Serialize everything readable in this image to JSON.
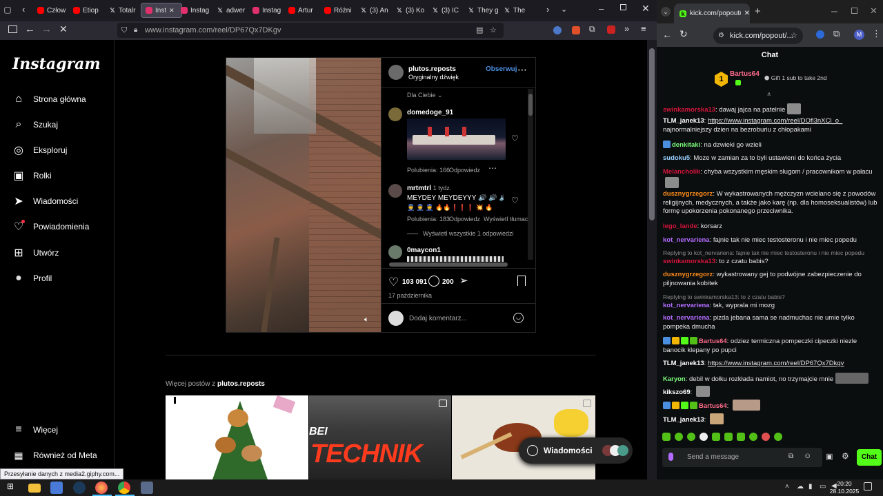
{
  "firefox": {
    "tabs": [
      {
        "label": "Człow",
        "icon": "youtube-icon",
        "color": "#ff0000"
      },
      {
        "label": "Etiop",
        "icon": "youtube-icon",
        "color": "#ff0000"
      },
      {
        "label": "Totalr",
        "icon": "x-icon",
        "color": "#ffffff"
      },
      {
        "label": "Inst",
        "icon": "instagram-icon",
        "color": "#e1306c",
        "active": true
      },
      {
        "label": "Instag",
        "icon": "instagram-icon",
        "color": "#e1306c"
      },
      {
        "label": "adwer",
        "icon": "x-icon",
        "color": "#ffffff"
      },
      {
        "label": "Instag",
        "icon": "instagram-icon",
        "color": "#e1306c"
      },
      {
        "label": "Artur",
        "icon": "youtube-icon",
        "color": "#ff0000"
      },
      {
        "label": "Różni",
        "icon": "youtube-icon",
        "color": "#ff0000"
      },
      {
        "label": "(3) An",
        "icon": "x-icon",
        "color": "#ffffff"
      },
      {
        "label": "(3) Ko",
        "icon": "x-icon",
        "color": "#ffffff"
      },
      {
        "label": "(3) IC",
        "icon": "x-icon",
        "color": "#ffffff"
      },
      {
        "label": "They g",
        "icon": "x-icon",
        "color": "#ffffff"
      },
      {
        "label": "The",
        "icon": "x-icon",
        "color": "#ffffff"
      }
    ],
    "url": "www.instagram.com/reel/DP67Qx7DKgv",
    "status_text": "Przesyłanie danych z media2.giphy.com..."
  },
  "instagram": {
    "logo": "Instagram",
    "nav": [
      {
        "label": "Strona główna",
        "icon": "home-icon"
      },
      {
        "label": "Szukaj",
        "icon": "search-icon"
      },
      {
        "label": "Eksploruj",
        "icon": "compass-icon"
      },
      {
        "label": "Rolki",
        "icon": "reels-icon"
      },
      {
        "label": "Wiadomości",
        "icon": "send-icon"
      },
      {
        "label": "Powiadomienia",
        "icon": "heart-icon"
      },
      {
        "label": "Utwórz",
        "icon": "plus-icon"
      },
      {
        "label": "Profil",
        "icon": "profile-icon"
      }
    ],
    "more_label": "Więcej",
    "meta_label": "Również od Meta",
    "post": {
      "username": "plutos.reposts",
      "audio": "Oryginalny dźwięk",
      "follow_label": "Obserwuj",
      "sort_label": "Dla Ciebie",
      "comments": [
        {
          "user": "domedoge_91",
          "text": "",
          "likes": "Polubienia: 166",
          "reply": "Odpowiedz"
        },
        {
          "user": "mrtmtrl",
          "time": "1 tydz.",
          "text": "MEYDEY MEYDEYYY 🔊 🔊 🔊 🔊",
          "text2": "👮 👮 👮 🔥🔥❗❗❗ 💥 🔥",
          "likes": "Polubienia: 183",
          "reply": "Odpowiedz",
          "translate": "Wyświetl tłumacz",
          "view_replies": "Wyświetl wszystkie 1 odpowiedzi"
        },
        {
          "user": "0maycon1",
          "text": ""
        }
      ],
      "likes_count": "103 091",
      "comments_count": "200",
      "date": "17 października",
      "comment_placeholder": "Dodaj komentarz..."
    },
    "more_posts_prefix": "Więcej postów z ",
    "more_posts_user": "plutos.reposts",
    "thumb2_text": "TECHNIK",
    "thumb2_prefix": "BEI",
    "messages_label": "Wiadomości"
  },
  "chrome": {
    "tab_title": "kick.com/popout/khamires/cha",
    "url": "kick.com/popout/...",
    "profile_initial": "M"
  },
  "kick": {
    "chat_title": "Chat",
    "pinned_user": "Bartus64",
    "pinned_rank": "1",
    "pinned_text": "Gift 1 sub to take 2nd",
    "messages": [
      {
        "user": "swinkamorska13",
        "color": "#d4143c",
        "text": "dawaj jajca na patelnie"
      },
      {
        "user": "TLM_janek13",
        "color": "#ffffff",
        "link": "https://www.instagram.com/reel/DOfl3nXCl_o_",
        "text": "najnormalniejszy dzien na bezroburiu z chłopakami"
      },
      {
        "user": "denkitaki",
        "color": "#7cfc7c",
        "text": "na dzwieki go wzieli"
      },
      {
        "user": "sudoku5",
        "color": "#9ad0ff",
        "text": "Moze w zamian za to byli ustawieni do końca życia"
      },
      {
        "user": "Melancholik",
        "color": "#d4143c",
        "text": "chyba wszystkim męskim sługom / pracownikom w pałacu"
      },
      {
        "user": "dusznygrzegorz",
        "color": "#ff8c1a",
        "text": "W wykastrowanych mężczyzn wcielano się z powodów religijnych, medycznych, a także jako karę (np. dla homoseksualistów) lub formę upokorzenia pokonanego przeciwnika."
      },
      {
        "user": "lego_lande",
        "color": "#d4143c",
        "text": "korsarz"
      },
      {
        "user": "kot_nervariena",
        "color": "#b36cff",
        "text": "fajnie tak nie miec testosteronu i nie miec popedu"
      },
      {
        "reply": "Replying to kot_nervariena: fajnie tak nie miec testosteronu i nie miec popedu",
        "user": "swinkamorska13",
        "color": "#d4143c",
        "text": "to z czatu babis?"
      },
      {
        "user": "dusznygrzegorz",
        "color": "#ff8c1a",
        "text": "wykastrowany gej to podwójne zabezpieczenie do piljnowania kobitek"
      },
      {
        "reply": "Replying to swinkamorska13: to z czatu babis?",
        "user": "kot_nervariena",
        "color": "#b36cff",
        "text": "tak, wyprala mi mozg"
      },
      {
        "user": "kot_nervariena",
        "color": "#b36cff",
        "text": "pizda jebana sama se nadmuchac nie umie tylko pompeka dmucha"
      },
      {
        "user": "Bartus64",
        "color": "#ff6b8b",
        "text": "odziez termiczna pompeczki cipeczki niezle banocik klepany po pupci"
      },
      {
        "user": "TLM_janek13",
        "color": "#ffffff",
        "link": "https://www.instagram.com/reel/DP67Qx7Dkgv",
        "text": ""
      },
      {
        "user": "Karyon",
        "color": "#7cfc7c",
        "text": "debil w dołku rozkłada namiot, no trzymajcie mnie"
      },
      {
        "user": "kikszo69",
        "color": "#ffffff",
        "text": ""
      },
      {
        "user": "Bartus64",
        "color": "#ff6b8b",
        "text": ""
      },
      {
        "user": "TLM_janek13",
        "color": "#ffffff",
        "text": ""
      }
    ],
    "input_placeholder": "Send a message",
    "send_label": "Chat"
  },
  "taskbar": {
    "time": "20:20",
    "date": "28.10.2025"
  }
}
